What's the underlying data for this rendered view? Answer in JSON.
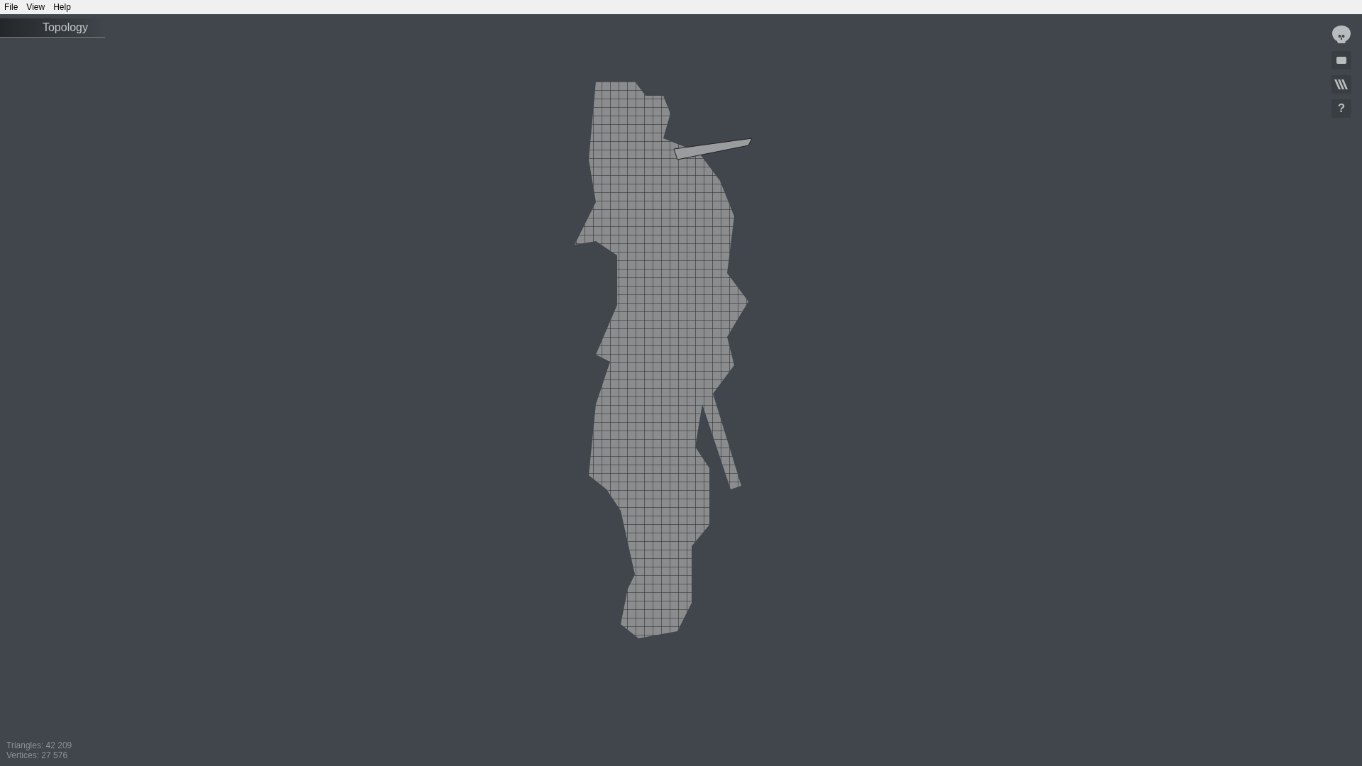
{
  "menu_bar": [
    "File",
    "View",
    "Help"
  ],
  "viewport": {
    "mode_tab": "Topology",
    "help_icon": "?",
    "stats": [
      "Triangles: 42 209",
      "Vertices: 27 576"
    ]
  }
}
